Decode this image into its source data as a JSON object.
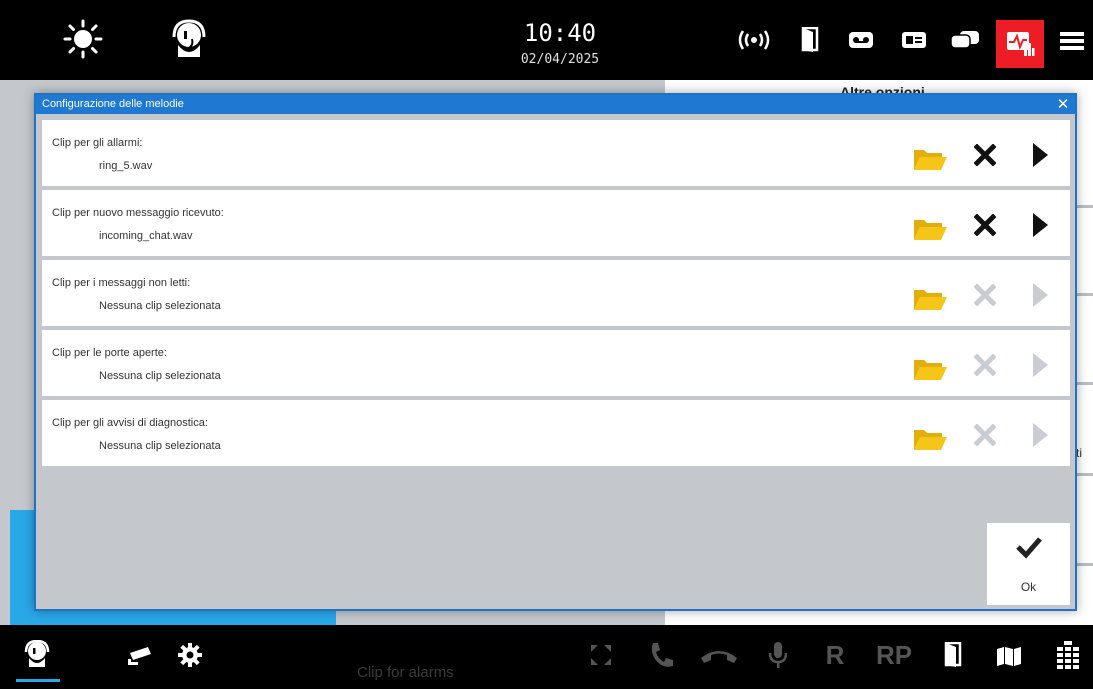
{
  "topbar": {
    "time": "10:40",
    "date": "02/04/2025",
    "icons": [
      "brightness-icon",
      "operator-headset-icon",
      "broadcast-icon",
      "door-icon",
      "voicemail-icon",
      "id-card-icon",
      "chat-icon",
      "diagnostics-icon",
      "menu-icon"
    ],
    "active_icon": "diagnostics-icon",
    "active_color": "#ee1c24"
  },
  "background": {
    "heading": "Altre opzioni",
    "fragment": "ti"
  },
  "dialog": {
    "title": "Configurazione delle melodie",
    "accent_color": "#1f78d1",
    "rows": [
      {
        "label": "Clip per gli allarmi:",
        "value": "ring_5.wav",
        "enabled": true
      },
      {
        "label": "Clip per nuovo messaggio ricevuto:",
        "value": "incoming_chat.wav",
        "enabled": true
      },
      {
        "label": "Clip per i messaggi non letti:",
        "value": "Nessuna clip selezionata",
        "enabled": false
      },
      {
        "label": "Clip per le porte aperte:",
        "value": "Nessuna clip selezionata",
        "enabled": false
      },
      {
        "label": "Clip per gli avvisi di diagnostica:",
        "value": "Nessuna clip selezionata",
        "enabled": false
      }
    ],
    "folder_color": "#f5c518",
    "ok_label": "Ok"
  },
  "bottombar": {
    "icons": [
      "operator-icon",
      "camera-icon",
      "settings-icon",
      "fullscreen-icon",
      "phone-icon",
      "hangup-icon",
      "microphone-icon",
      "r-label",
      "rp-label",
      "door-icon",
      "map-icon",
      "keypad-icon"
    ],
    "r_label": "R",
    "rp_label": "RP",
    "accent_color": "#29a8e8"
  },
  "caption": "Clip for alarms"
}
